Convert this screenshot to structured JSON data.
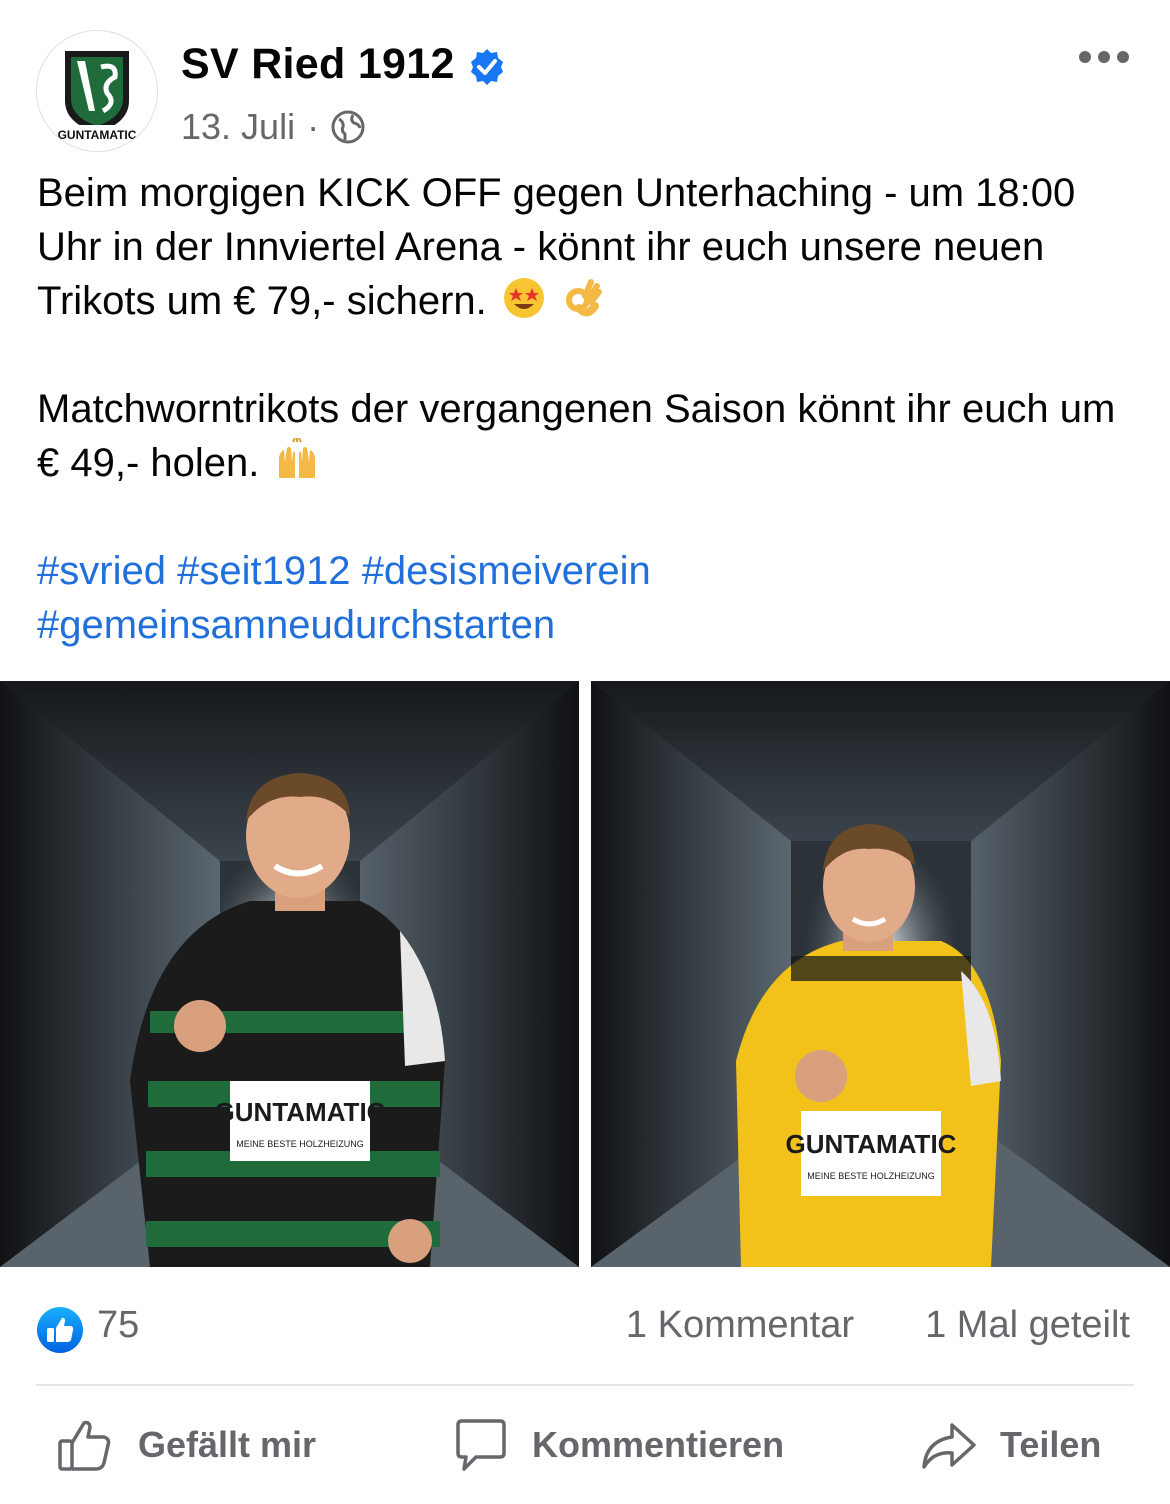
{
  "post": {
    "page_name": "SV Ried 1912",
    "date": "13. Juli",
    "separator": "·",
    "avatar_logo_text": "GUNTAMATIC",
    "icons": {
      "verified": "verified-badge-icon",
      "privacy": "globe-icon",
      "more": "more-options-icon"
    },
    "text": {
      "paragraph1": "Beim morgigen KICK OFF gegen Unterhaching - um 18:00 Uhr in der Innviertel Arena - könnt ihr euch unsere neuen Trikots um € 79,- sichern.",
      "paragraph1_emojis": [
        "star-struck-emoji",
        "ok-hand-emoji"
      ],
      "paragraph2": "Matchworntrikots der vergangenen Saison könnt ihr euch um € 49,- holen.",
      "paragraph2_emoji": "raising-hands-emoji",
      "hashtags": [
        "#svried",
        "#seit1912",
        "#desismeiverein",
        "#gemeinsamneudurchstarten"
      ]
    },
    "photos": [
      {
        "description_kind": "player-green-jersey",
        "jersey_sponsor": "GUNTAMATIC",
        "jersey_tagline": "MEINE BESTE HOLZHEIZUNG",
        "jersey_color": "#1f6b3a"
      },
      {
        "description_kind": "player-yellow-jersey",
        "jersey_sponsor": "GUNTAMATIC",
        "jersey_tagline": "MEINE BESTE HOLZHEIZUNG",
        "jersey_color": "#f2c21a"
      }
    ]
  },
  "stats": {
    "likes": "75",
    "comments": "1 Kommentar",
    "shares": "1 Mal geteilt"
  },
  "actions": {
    "like": "Gefällt mir",
    "comment": "Kommentieren",
    "share": "Teilen"
  },
  "colors": {
    "link": "#216fdb",
    "secondary_text": "#65676b",
    "like_blue": "#1877f2"
  }
}
